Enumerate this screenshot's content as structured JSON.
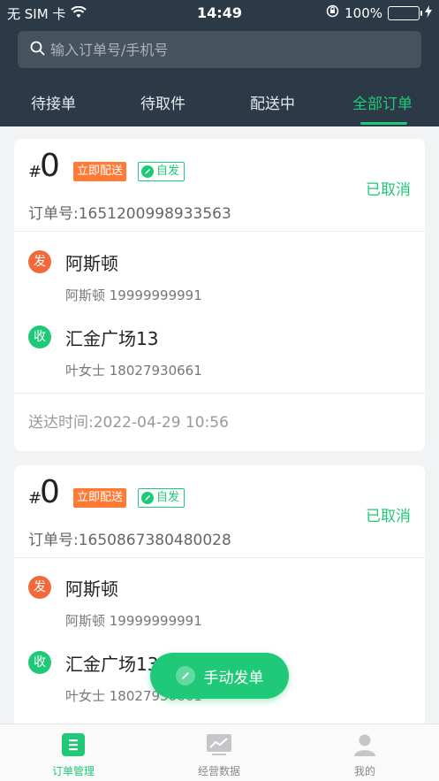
{
  "status_bar": {
    "carrier": "无 SIM 卡",
    "time": "14:49",
    "battery": "100%"
  },
  "search": {
    "placeholder": "输入订单号/手机号"
  },
  "tabs": [
    {
      "label": "待接单"
    },
    {
      "label": "待取件"
    },
    {
      "label": "配送中"
    },
    {
      "label": "全部订单"
    }
  ],
  "orders": [
    {
      "hash": "#",
      "number": "0",
      "tag_instant": "立即配送",
      "tag_self": "自发",
      "status": "已取消",
      "order_no": "订单号:1651200998933563",
      "sender": {
        "badge": "发",
        "address": "阿斯顿",
        "contact": "阿斯顿  19999999991"
      },
      "receiver": {
        "badge": "收",
        "address": "汇金广场13",
        "contact": "叶女士  18027930661"
      },
      "deliver_time": "送达时间:2022-04-29 10:56"
    },
    {
      "hash": "#",
      "number": "0",
      "tag_instant": "立即配送",
      "tag_self": "自发",
      "status": "已取消",
      "order_no": "订单号:1650867380480028",
      "sender": {
        "badge": "发",
        "address": "阿斯顿",
        "contact": "阿斯顿  19999999991"
      },
      "receiver": {
        "badge": "收",
        "address": "汇金广场13",
        "contact": "叶女士  18027930661"
      }
    }
  ],
  "fab": {
    "label": "手动发单"
  },
  "bottom_nav": [
    {
      "label": "订单管理",
      "icon": "order-icon"
    },
    {
      "label": "经营数据",
      "icon": "chart-icon"
    },
    {
      "label": "我的",
      "icon": "user-icon"
    }
  ],
  "colors": {
    "accent": "#1fc977",
    "header": "#2c3a47",
    "instant_tag": "#ff7a35",
    "send_badge": "#f06a3c"
  }
}
